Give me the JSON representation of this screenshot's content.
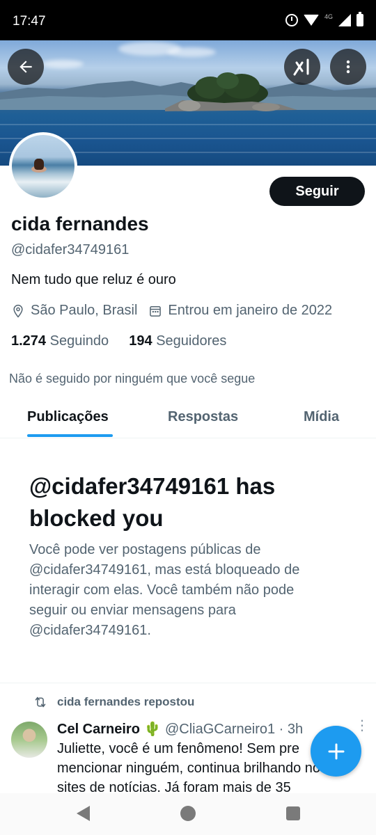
{
  "status_bar": {
    "time": "17:47",
    "network": "4G"
  },
  "header": {
    "back_icon": "arrow-left-icon",
    "grok_icon": "grok-icon",
    "more_icon": "more-vertical-icon"
  },
  "profile": {
    "follow_label": "Seguir",
    "name": "cida fernandes",
    "handle": "@cidafer34749161",
    "bio": "Nem tudo que reluz é ouro",
    "location": "São Paulo, Brasil",
    "joined": "Entrou em janeiro de 2022",
    "following_count": "1.274",
    "following_label": "Seguindo",
    "followers_count": "194",
    "followers_label": "Seguidores",
    "followed_by": "Não é seguido por ninguém que você segue"
  },
  "tabs": [
    {
      "label": "Publicações",
      "active": true
    },
    {
      "label": "Respostas",
      "active": false
    },
    {
      "label": "Mídia",
      "active": false
    }
  ],
  "blocked": {
    "title": "@cidafer34749161 has blocked you",
    "body": "Você pode ver postagens públicas de @cidafer34749161, mas está bloqueado de interagir com elas. Você também não pode seguir ou enviar mensagens para @cidafer34749161."
  },
  "tweet": {
    "repost_label": "cida fernandes repostou",
    "author_name": "Cel Carneiro",
    "author_emoji": "🌵",
    "author_handle": "@CliaGCarneiro1",
    "time": "· 3h",
    "text": "Juliette, você é um fenômeno! Sem pre mencionar ninguém, continua brilhando nos sites de notícias. Já foram mais de 35"
  },
  "colors": {
    "accent": "#1d9bf0",
    "text_primary": "#0f1419",
    "text_secondary": "#536471",
    "follow_button": "#0f1419"
  }
}
